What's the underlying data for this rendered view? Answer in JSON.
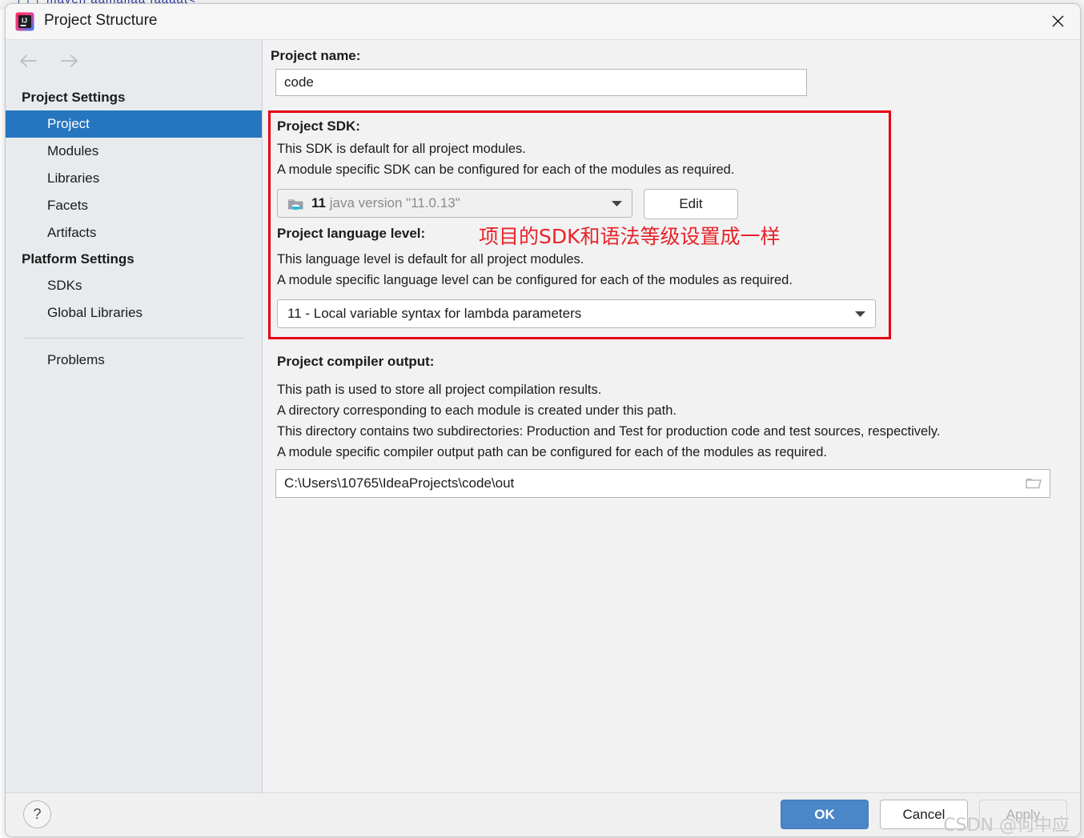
{
  "background": {
    "ide_strip_text": "┌┬┐ maven  aamaiiaa  faaaat<"
  },
  "window": {
    "title": "Project Structure",
    "app_icon": "intellij-idea-icon",
    "close_icon": "close-icon"
  },
  "nav": {
    "back_icon": "arrow-left-icon",
    "forward_icon": "arrow-right-icon"
  },
  "sidebar": {
    "groups": [
      {
        "label": "Project Settings",
        "items": [
          {
            "label": "Project",
            "selected": true
          },
          {
            "label": "Modules",
            "selected": false
          },
          {
            "label": "Libraries",
            "selected": false
          },
          {
            "label": "Facets",
            "selected": false
          },
          {
            "label": "Artifacts",
            "selected": false
          }
        ]
      },
      {
        "label": "Platform Settings",
        "items": [
          {
            "label": "SDKs",
            "selected": false
          },
          {
            "label": "Global Libraries",
            "selected": false
          }
        ]
      }
    ],
    "extra_item": {
      "label": "Problems"
    }
  },
  "main": {
    "project_name": {
      "label": "Project name:",
      "value": "code"
    },
    "project_sdk": {
      "label": "Project SDK:",
      "descriptions": [
        "This SDK is default for all project modules.",
        "A module specific SDK can be configured for each of the modules as required."
      ],
      "combo": {
        "icon": "java-sdk-folder-icon",
        "version": "11",
        "detail": "java version \"11.0.13\"",
        "arrow_icon": "chevron-down-icon"
      },
      "edit_button": "Edit"
    },
    "project_language_level": {
      "label": "Project language level:",
      "descriptions": [
        "This language level is default for all project modules.",
        "A module specific language level can be configured for each of the modules as required."
      ],
      "combo": {
        "value": "11 - Local variable syntax for lambda parameters",
        "arrow_icon": "chevron-down-icon"
      }
    },
    "annotation": {
      "text": "项目的SDK和语法等级设置成一样",
      "color": "#e8232a"
    },
    "project_compiler_output": {
      "label": "Project compiler output:",
      "descriptions": [
        "This path is used to store all project compilation results.",
        "A directory corresponding to each module is created under this path.",
        "This directory contains two subdirectories: Production and Test for production code and test sources, respectively.",
        "A module specific compiler output path can be configured for each of the modules as required."
      ],
      "path_value": "C:\\Users\\10765\\IdeaProjects\\code\\out",
      "browse_icon": "folder-icon"
    }
  },
  "footer": {
    "help_label": "?",
    "buttons": [
      {
        "label": "OK",
        "style": "primary"
      },
      {
        "label": "Cancel",
        "style": "normal"
      },
      {
        "label": "Apply",
        "style": "disabled"
      }
    ]
  },
  "watermark": {
    "text": "CSDN @何中应"
  },
  "colors": {
    "selection_blue": "#2675bf",
    "primary_button": "#4a86c8",
    "annotation_red": "#e60012",
    "sidebar_bg": "#e8ebee",
    "panel_bg": "#f2f2f2"
  }
}
